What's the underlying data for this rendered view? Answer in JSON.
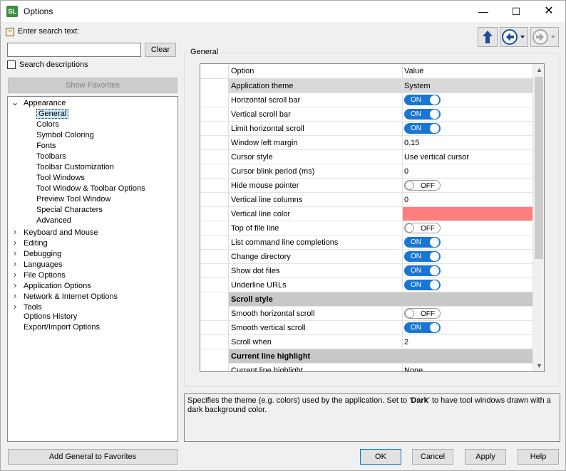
{
  "window": {
    "title": "Options",
    "icon": "sl-app-icon",
    "minimize": "—",
    "maximize": "☐",
    "close": "✕"
  },
  "search": {
    "toggle": "−",
    "label": "Enter search text:",
    "input_value": "",
    "clear_label": "Clear",
    "search_descriptions_label": "Search descriptions",
    "search_descriptions_checked": false
  },
  "favorites": {
    "show_label": "Show Favorites",
    "add_label": "Add General to Favorites"
  },
  "tree": [
    {
      "label": "Appearance",
      "level": 0,
      "expanded": true,
      "has_children": true
    },
    {
      "label": "General",
      "level": 1,
      "selected": true
    },
    {
      "label": "Colors",
      "level": 1
    },
    {
      "label": "Symbol Coloring",
      "level": 1
    },
    {
      "label": "Fonts",
      "level": 1
    },
    {
      "label": "Toolbars",
      "level": 1
    },
    {
      "label": "Toolbar Customization",
      "level": 1
    },
    {
      "label": "Tool Windows",
      "level": 1
    },
    {
      "label": "Tool Window & Toolbar Options",
      "level": 1
    },
    {
      "label": "Preview Tool Window",
      "level": 1
    },
    {
      "label": "Special Characters",
      "level": 1
    },
    {
      "label": "Advanced",
      "level": 1
    },
    {
      "label": "Keyboard and Mouse",
      "level": 0,
      "has_children": true
    },
    {
      "label": "Editing",
      "level": 0,
      "has_children": true
    },
    {
      "label": "Debugging",
      "level": 0,
      "has_children": true
    },
    {
      "label": "Languages",
      "level": 0,
      "has_children": true
    },
    {
      "label": "File Options",
      "level": 0,
      "has_children": true
    },
    {
      "label": "Application Options",
      "level": 0,
      "has_children": true
    },
    {
      "label": "Network & Internet Options",
      "level": 0,
      "has_children": true
    },
    {
      "label": "Tools",
      "level": 0,
      "has_children": true
    },
    {
      "label": "Options History",
      "level": 0,
      "has_children": false
    },
    {
      "label": "Export/Import Options",
      "level": 0,
      "has_children": false
    }
  ],
  "panel": {
    "group_label": "General",
    "nav": {
      "up": "arrow-up-icon",
      "back": "arrow-left-icon",
      "forward": "arrow-right-icon"
    },
    "columns": {
      "option": "Option",
      "value": "Value"
    },
    "rows": [
      {
        "option": "Application theme",
        "type": "text",
        "value": "System",
        "highlight": true
      },
      {
        "option": "Horizontal scroll bar",
        "type": "toggle",
        "value": "ON"
      },
      {
        "option": "Vertical scroll bar",
        "type": "toggle",
        "value": "ON"
      },
      {
        "option": "Limit horizontal scroll",
        "type": "toggle",
        "value": "ON"
      },
      {
        "option": "Window left margin",
        "type": "text",
        "value": "0.15"
      },
      {
        "option": "Cursor style",
        "type": "text",
        "value": "Use vertical cursor"
      },
      {
        "option": "Cursor blink period (ms)",
        "type": "text",
        "value": "0"
      },
      {
        "option": "Hide mouse pointer",
        "type": "toggle",
        "value": "OFF"
      },
      {
        "option": "Vertical line columns",
        "type": "text",
        "value": "0"
      },
      {
        "option": "Vertical line color",
        "type": "color",
        "value": "",
        "color": "#ff7f7f"
      },
      {
        "option": "Top of file line",
        "type": "toggle",
        "value": "OFF"
      },
      {
        "option": "List command line completions",
        "type": "toggle",
        "value": "ON"
      },
      {
        "option": "Change directory",
        "type": "toggle",
        "value": "ON"
      },
      {
        "option": "Show dot files",
        "type": "toggle",
        "value": "ON"
      },
      {
        "option": "Underline URLs",
        "type": "toggle",
        "value": "ON"
      },
      {
        "option": "Scroll style",
        "type": "section",
        "value": ""
      },
      {
        "option": "Smooth horizontal scroll",
        "type": "toggle",
        "value": "OFF"
      },
      {
        "option": "Smooth vertical scroll",
        "type": "toggle",
        "value": "ON"
      },
      {
        "option": "Scroll when",
        "type": "text",
        "value": "2"
      },
      {
        "option": "Current line highlight",
        "type": "section",
        "value": ""
      },
      {
        "option": "Current line highlight",
        "type": "text",
        "value": "None"
      }
    ],
    "description_pre": "Specifies the theme (e.g. colors) used by the application. Set to '",
    "description_bold": "Dark",
    "description_post": "' to have tool windows drawn with a dark background color."
  },
  "buttons": {
    "ok": "OK",
    "cancel": "Cancel",
    "apply": "Apply",
    "help": "Help"
  },
  "colors": {
    "toggle_on": "#1976d2",
    "section_bg": "#c8c8c8",
    "line_color_swatch": "#ff7f7f",
    "selection": "#cce8ff"
  }
}
